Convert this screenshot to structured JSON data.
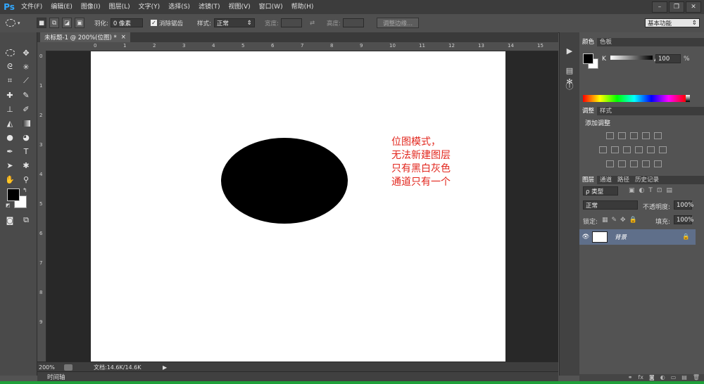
{
  "app": {
    "logo": "Ps"
  },
  "menu": [
    "文件(F)",
    "编辑(E)",
    "图像(I)",
    "图层(L)",
    "文字(Y)",
    "选择(S)",
    "滤镜(T)",
    "视图(V)",
    "窗口(W)",
    "帮助(H)"
  ],
  "window_controls": [
    "–",
    "❐",
    "✕"
  ],
  "options": {
    "feather_label": "羽化:",
    "feather_value": "0 像素",
    "antialias_label": "消除锯齿",
    "style_label": "样式:",
    "style_value": "正常",
    "width_label": "宽度:",
    "height_label": "高度:",
    "refine_edge": "调整边缘...",
    "workspace": "基本功能"
  },
  "document": {
    "tab_title": "未标题-1 @ 200%(位图) *",
    "tab_close": "×",
    "annotation": [
      "位图模式，",
      "无法新建图层",
      "只有黑白灰色",
      "通道只有一个"
    ]
  },
  "ruler": {
    "top": [
      "0",
      "1",
      "2",
      "3",
      "4",
      "5",
      "6",
      "7",
      "8",
      "9",
      "10",
      "11",
      "12",
      "13",
      "14",
      "15"
    ],
    "left": [
      "0",
      "1",
      "2",
      "3",
      "4",
      "5",
      "6",
      "7",
      "8",
      "9"
    ]
  },
  "status": {
    "zoom": "200%",
    "doc_info": "文档:14.6K/14.6K"
  },
  "timeline": {
    "label": "时间轴"
  },
  "panels": {
    "color": {
      "tabs": [
        "颜色",
        "色板"
      ],
      "channel": "K",
      "value": "100",
      "unit": "%"
    },
    "adjustments": {
      "tabs": [
        "调整",
        "样式"
      ],
      "title": "添加调整"
    },
    "layers": {
      "tabs": [
        "图层",
        "通道",
        "路径",
        "历史记录"
      ],
      "filter": "ρ 类型",
      "blend": "正常",
      "opacity_label": "不透明度:",
      "opacity": "100%",
      "lock_label": "锁定:",
      "fill_label": "填充:",
      "fill": "100%",
      "layer_name": "背景"
    }
  },
  "colors": {
    "annotation": "#e2261d",
    "accent": "#31a8ff",
    "selected_layer": "#5f6f8a"
  }
}
